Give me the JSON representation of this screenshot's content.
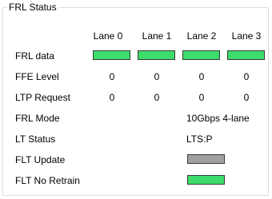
{
  "group": {
    "title": "FRL Status"
  },
  "lanes": [
    "Lane 0",
    "Lane 1",
    "Lane 2",
    "Lane 3"
  ],
  "labels": {
    "frl_data": "FRL data",
    "ffe_level": "FFE Level",
    "ltp_request": "LTP Request",
    "frl_mode": "FRL Mode",
    "lt_status": "LT Status",
    "flt_update": "FLT Update",
    "flt_no_retrain": "FLT No Retrain"
  },
  "frl_data": {
    "lane_indicators": [
      "green",
      "green",
      "green",
      "green"
    ]
  },
  "ffe_level": [
    "0",
    "0",
    "0",
    "0"
  ],
  "ltp_request": [
    "0",
    "0",
    "0",
    "0"
  ],
  "frl_mode_value": "10Gbps 4-lane",
  "lt_status_value": "LTS:P",
  "flt_update": {
    "indicator": "gray"
  },
  "flt_no_retrain": {
    "indicator": "green"
  },
  "colors": {
    "indicator_green": "#3ddc6a",
    "indicator_gray": "#a0a0a0",
    "group_border": "#d5dfe5"
  }
}
